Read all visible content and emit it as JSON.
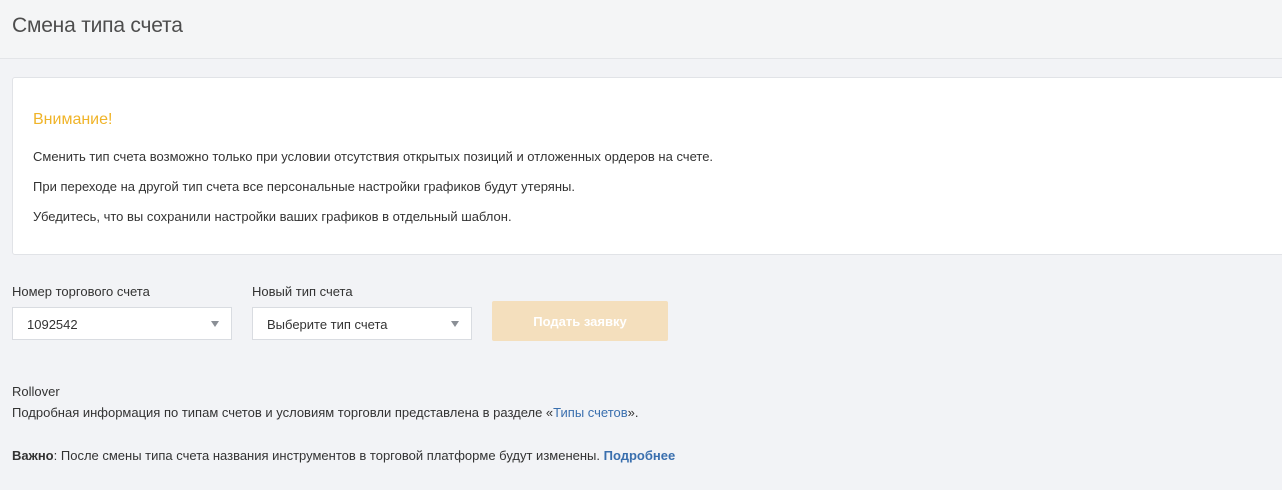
{
  "header": {
    "title": "Смена типа счета"
  },
  "warning": {
    "title": "Внимание!",
    "lines": [
      "Сменить тип счета возможно только при условии отсутствия открытых позиций и отложенных ордеров на счете.",
      "При переходе на другой тип счета все персональные настройки графиков будут утеряны.",
      "Убедитесь, что вы сохранили настройки ваших графиков в отдельный шаблон."
    ]
  },
  "form": {
    "account_label": "Номер торгового счета",
    "account_value": "1092542",
    "new_type_label": "Новый тип счета",
    "new_type_value": "Выберите тип счета",
    "submit_label": "Подать заявку"
  },
  "info": {
    "rollover": "Rollover",
    "details_prefix": "Подробная информация по типам счетов и условиям торговли представлена в разделе «",
    "details_link": "Типы счетов",
    "details_suffix": "».",
    "important_label": "Важно",
    "important_text": ": После смены типа счета названия инструментов в торговой платформе будут изменены. ",
    "more_link": "Подробнее"
  },
  "colors": {
    "warning_title": "#f0b429",
    "link": "#3a6fae",
    "button_disabled": "#f4dfbd",
    "background": "#f2f3f6"
  }
}
